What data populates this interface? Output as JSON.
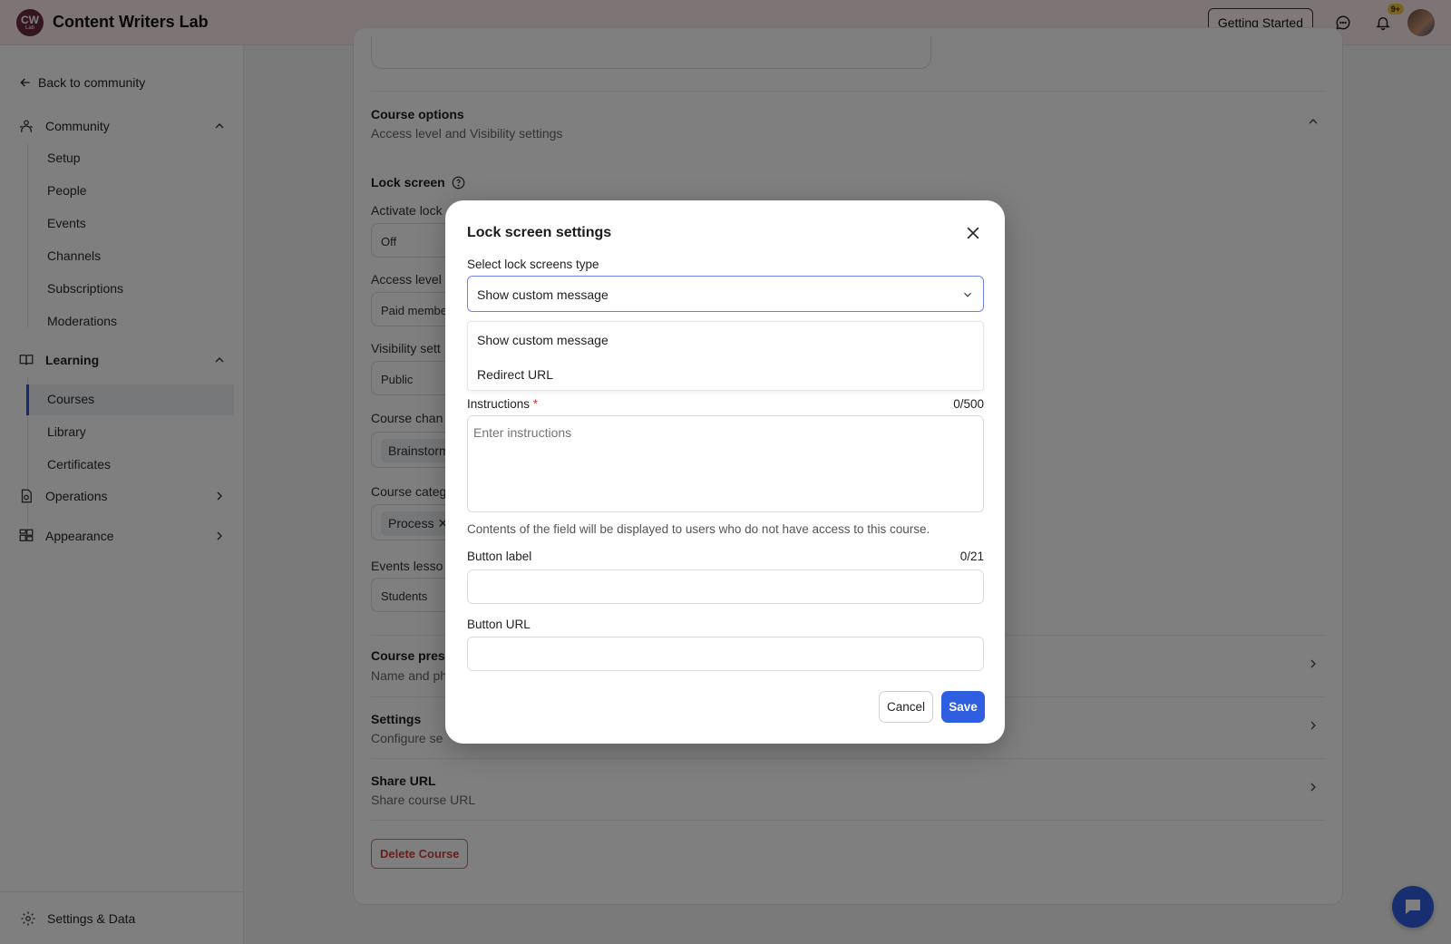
{
  "header": {
    "logo_initials": "CW",
    "logo_sub": "Lab",
    "brand": "Content Writers Lab",
    "getting_started": "Getting Started",
    "notification_badge": "9+"
  },
  "sidebar": {
    "back": "Back to community",
    "community": {
      "label": "Community",
      "items": [
        "Setup",
        "People",
        "Events",
        "Channels",
        "Subscriptions",
        "Moderations"
      ]
    },
    "learning": {
      "label": "Learning",
      "items": [
        "Courses",
        "Library",
        "Certificates"
      ]
    },
    "operations": "Operations",
    "appearance": "Appearance",
    "settings_data": "Settings & Data"
  },
  "main": {
    "course_options_title": "Course options",
    "course_options_sub": "Access level and Visibility settings",
    "lock_screen": "Lock screen",
    "fields": [
      {
        "label": "Activate lock",
        "value": "Off"
      },
      {
        "label": "Access level",
        "value": "Paid membe"
      },
      {
        "label": "Visibility sett",
        "value": "Public"
      },
      {
        "label": "Course chan",
        "value": "Brainstorm"
      },
      {
        "label": "Course categ",
        "value": "Process"
      },
      {
        "label": "Events lesso",
        "value": "Students"
      }
    ],
    "course_pres_title": "Course pres",
    "course_pres_sub": "Name and ph",
    "settings_title": "Settings",
    "settings_sub": "Configure se",
    "share_title": "Share URL",
    "share_sub": "Share course URL",
    "delete": "Delete Course"
  },
  "modal": {
    "title": "Lock screen settings",
    "select_label": "Select lock screens type",
    "selected": "Show custom message",
    "options": [
      "Show custom message",
      "Redirect URL"
    ],
    "instructions_label": "Instructions",
    "required_mark": "*",
    "instructions_count": "0/500",
    "instructions_placeholder": "Enter instructions",
    "helper": "Contents of the field will be displayed to users who do not have access to this course.",
    "button_label": "Button label",
    "button_label_count": "0/21",
    "button_url": "Button URL",
    "cancel": "Cancel",
    "save": "Save"
  },
  "colors": {
    "accent": "#2f5ee0",
    "header_bg": "#fbeaeb",
    "danger": "#d43c3c"
  }
}
